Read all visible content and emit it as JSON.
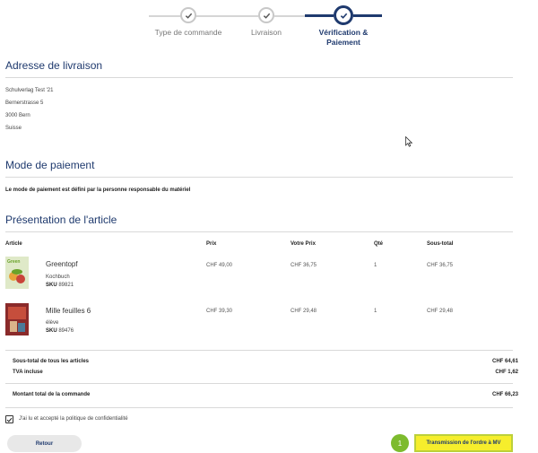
{
  "stepper": {
    "steps": [
      {
        "label": "Type de commande",
        "state": "done"
      },
      {
        "label": "Livraison",
        "state": "done"
      },
      {
        "label": "Vérification & Paiement",
        "state": "active"
      }
    ]
  },
  "address": {
    "title": "Adresse de livraison",
    "lines": [
      "Schulverlag Test '21",
      "Bernerstrasse 5",
      "3000 Bern",
      "Suisse"
    ]
  },
  "payment": {
    "title": "Mode de paiement",
    "text": "Le mode de paiement est défini par la personne responsable du matériel"
  },
  "articles": {
    "title": "Présentation de l'article",
    "headers": {
      "article": "Article",
      "prix": "Prix",
      "votre_prix": "Votre Prix",
      "qte": "Qté",
      "sous_total": "Sous-total"
    },
    "items": [
      {
        "name": "Greentopf",
        "sub": "Kochbuch",
        "sku_label": "SKU",
        "sku": "89821",
        "prix": "CHF 49,00",
        "votre_prix": "CHF 36,75",
        "qte": "1",
        "sous_total": "CHF 36,75",
        "cover_text": "Green"
      },
      {
        "name": "Mille feuilles 6",
        "sub": "élève",
        "sku_label": "SKU",
        "sku": "89476",
        "prix": "CHF 39,30",
        "votre_prix": "CHF 29,48",
        "qte": "1",
        "sous_total": "CHF 29,48"
      }
    ]
  },
  "totals": {
    "subtotal_label": "Sous-total de tous les articles",
    "subtotal_value": "CHF 64,61",
    "tva_label": "TVA incluse",
    "tva_value": "CHF 1,62",
    "total_label": "Montant total de la commande",
    "total_value": "CHF 66,23"
  },
  "privacy": {
    "label": "J'ai lu et accepté la politique de confidentialité",
    "checked": true
  },
  "buttons": {
    "back": "Retour",
    "badge": "1",
    "submit": "Transmission de l'ordre à MV"
  },
  "colors": {
    "accent": "#1f3a6e",
    "highlight": "#f6ee2c",
    "badge": "#7dbb2e"
  }
}
